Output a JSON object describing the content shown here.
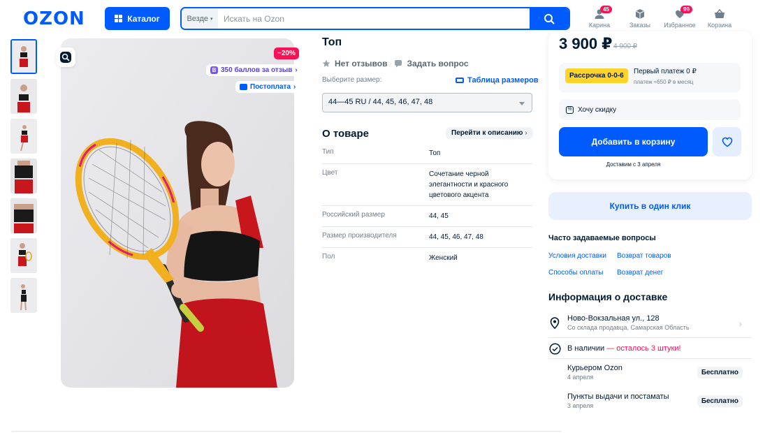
{
  "header": {
    "logo": "OZON",
    "catalog_label": "Каталог",
    "search_scope": "Везде",
    "search_placeholder": "Искать на Ozon",
    "cart": {
      "label": "Карина",
      "badge": "45"
    },
    "orders": {
      "label": "Заказы"
    },
    "favorites": {
      "label": "Избранное",
      "badge": "99"
    },
    "basket": {
      "label": "Корзина"
    }
  },
  "gallery": {
    "thumbnail_count": 7,
    "discount": "−20%",
    "points_promo": "350 баллов за отзыв",
    "postpay_promo": "Постоплата"
  },
  "product": {
    "title": "Топ",
    "no_reviews": "Нет отзывов",
    "ask_question": "Задать вопрос",
    "size_label": "Выберите размер:",
    "size_table_link": "Таблица размеров",
    "selected_size": "44—45 RU / 44, 45, 46, 47, 48",
    "about_title": "О товаре",
    "to_description": "Перейти к описанию",
    "attributes": [
      {
        "key": "Тип",
        "value": "Топ"
      },
      {
        "key": "Цвет",
        "value": "Сочетание черной элегантности и красного цветового акцента"
      },
      {
        "key": "Российский размер",
        "value": "44, 45"
      },
      {
        "key": "Размер производителя",
        "value": "44, 45, 46, 47, 48"
      },
      {
        "key": "Пол",
        "value": "Женский"
      }
    ]
  },
  "purchase": {
    "price": "3 900 ₽",
    "price_old": "4 900 ₽",
    "installment_badge": "Рассрочка 0-0-6",
    "installment_first": "Первый платеж 0 ₽",
    "installment_sub": "платеж ≈650 ₽ в месяц",
    "want_discount": "Хочу скидку",
    "add_to_cart": "Добавить в корзину",
    "deliver_date": "Доставим с 3 апреля",
    "one_click": "Купить в один клик"
  },
  "faq": {
    "title": "Часто задаваемые вопросы",
    "links": [
      "Условия доставки",
      "Возврат товаров",
      "Способы оплаты",
      "Возврат денег"
    ]
  },
  "delivery": {
    "title": "Информация о доставке",
    "address": "Ново-Вокзальная ул., 128",
    "address_sub": "Со склада продавца, Самарская Область",
    "stock_prefix": "В наличии",
    "stock_warn": " — осталось 3 штуки!",
    "options": [
      {
        "name": "Курьером Ozon",
        "date": "4 апреля",
        "price": "Бесплатно"
      },
      {
        "name": "Пункты выдачи и постаматы",
        "date": "3 апреля",
        "price": "Бесплатно"
      }
    ]
  },
  "colors": {
    "brand": "#005bff",
    "accent_pink": "#f91155",
    "installment_yellow": "#fed42b"
  }
}
